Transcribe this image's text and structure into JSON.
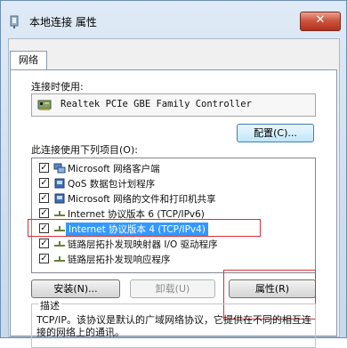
{
  "window": {
    "title": "本地连接 属性",
    "close_label": "✕"
  },
  "tabs": [
    {
      "label": "网络"
    }
  ],
  "connect_using": {
    "label": "连接时使用:",
    "adapter": "Realtek PCIe GBE Family Controller",
    "configure_button": "配置(C)..."
  },
  "items_section": {
    "label": "此连接使用下列项目(O):",
    "items": [
      {
        "label": "Microsoft 网络客户端",
        "checked": true
      },
      {
        "label": "QoS 数据包计划程序",
        "checked": true
      },
      {
        "label": "Microsoft 网络的文件和打印机共享",
        "checked": true
      },
      {
        "label": "Internet 协议版本 6 (TCP/IPv6)",
        "checked": true
      },
      {
        "label": "Internet 协议版本 4 (TCP/IPv4)",
        "checked": true,
        "selected": true
      },
      {
        "label": "链路层拓扑发现映射器 I/O 驱动程序",
        "checked": true
      },
      {
        "label": "链路层拓扑发现响应程序",
        "checked": true
      }
    ]
  },
  "buttons": {
    "install": "安装(N)...",
    "uninstall": "卸载(U)",
    "properties": "属性(R)"
  },
  "description": {
    "legend": "描述",
    "text": "TCP/IP。该协议是默认的广域网络协议，它提供在不同的相互连接的网络上的通讯。"
  },
  "colors": {
    "selection": "#3399ff",
    "highlight_box": "#d92f38",
    "close_button": "#c9503a"
  }
}
